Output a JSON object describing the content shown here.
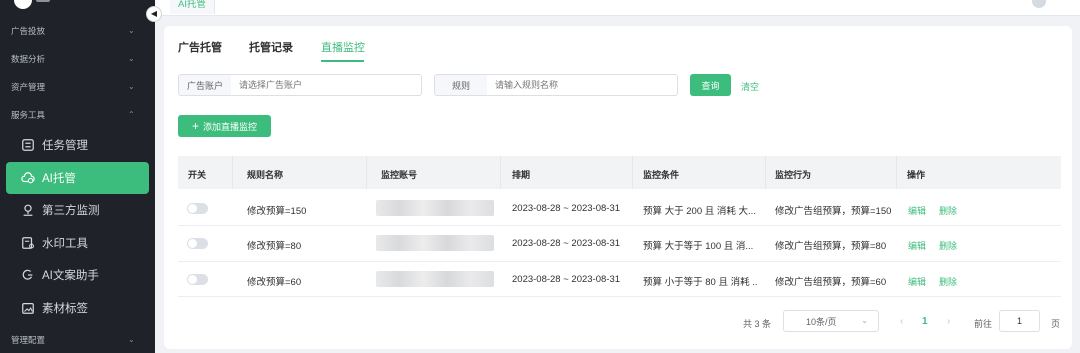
{
  "sidebar": {
    "groups": [
      {
        "label": "广告投放"
      },
      {
        "label": "数据分析"
      },
      {
        "label": "资产管理"
      },
      {
        "label": "服务工具"
      },
      {
        "label": "管理配置"
      }
    ],
    "items": [
      {
        "label": "任务管理",
        "icon": "task-list-icon"
      },
      {
        "label": "AI托管",
        "icon": "ai-cloud-icon"
      },
      {
        "label": "第三方监测",
        "icon": "location-pin-icon"
      },
      {
        "label": "水印工具",
        "icon": "watermark-icon"
      },
      {
        "label": "AI文案助手",
        "icon": "ai-copy-icon"
      },
      {
        "label": "素材标签",
        "icon": "tag-image-icon"
      }
    ]
  },
  "topbar": {
    "tab": "AI托管"
  },
  "tabs": [
    {
      "label": "广告托管"
    },
    {
      "label": "托管记录"
    },
    {
      "label": "直播监控"
    }
  ],
  "filters": {
    "account_label": "广告账户",
    "account_placeholder": "请选择广告账户",
    "rule_label": "规则",
    "rule_placeholder": "请输入规则名称",
    "query_button": "查询",
    "clear_link": "清空"
  },
  "add_button": "添加直播监控",
  "table": {
    "headers": [
      "开关",
      "规则名称",
      "监控账号",
      "排期",
      "监控条件",
      "监控行为",
      "操作"
    ],
    "rows": [
      {
        "name": "修改预算=150",
        "schedule": "2023-08-28 ~ 2023-08-31",
        "condition": "预算 大于 200 且 消耗 大...",
        "action": "修改广告组预算，预算=150"
      },
      {
        "name": "修改预算=80",
        "schedule": "2023-08-28 ~ 2023-08-31",
        "condition": "预算 大于等于 100 且 消...",
        "action": "修改广告组预算，预算=80"
      },
      {
        "name": "修改预算=60",
        "schedule": "2023-08-28 ~ 2023-08-31",
        "condition": "预算 小于等于 80 且 消耗 ...",
        "action": "修改广告组预算，预算=60"
      }
    ],
    "edit_label": "编辑",
    "delete_label": "删除"
  },
  "pagination": {
    "total": "共 3 条",
    "page_size": "10条/页",
    "current_page": "1",
    "goto_label": "前往",
    "goto_value": "1",
    "page_suffix": "页"
  },
  "colors": {
    "accent": "#3dbd7d",
    "sidebar_bg": "#1f2329"
  }
}
